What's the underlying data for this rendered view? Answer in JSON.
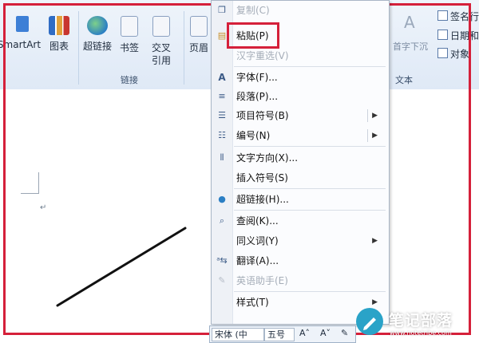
{
  "ribbon": {
    "buttons": [
      {
        "label": "SmartArt"
      },
      {
        "label": "图表"
      },
      {
        "label": "超链接"
      },
      {
        "label": "书签"
      },
      {
        "label": "交叉\n引用"
      },
      {
        "label": "页眉"
      }
    ],
    "group_links": "链接",
    "group_text": "文本",
    "first_letter": "首字下沉",
    "right_items": [
      "签名行",
      "日期和",
      "对象"
    ]
  },
  "context_menu": {
    "items": [
      {
        "label": "复制(C)",
        "disabled": true
      },
      {
        "label": "粘贴(P)",
        "disabled": false
      },
      {
        "label": "汉字重选(V)",
        "disabled": true
      },
      {
        "label": "字体(F)...",
        "disabled": false
      },
      {
        "label": "段落(P)...",
        "disabled": false
      },
      {
        "label": "项目符号(B)",
        "disabled": false,
        "submenu": true
      },
      {
        "label": "编号(N)",
        "disabled": false,
        "submenu": true
      },
      {
        "label": "文字方向(X)...",
        "disabled": false
      },
      {
        "label": "插入符号(S)",
        "disabled": false
      },
      {
        "label": "超链接(H)...",
        "disabled": false
      },
      {
        "label": "查阅(K)...",
        "disabled": false
      },
      {
        "label": "同义词(Y)",
        "disabled": false,
        "submenu": true
      },
      {
        "label": "翻译(A)...",
        "disabled": false
      },
      {
        "label": "英语助手(E)",
        "disabled": true
      },
      {
        "label": "样式(T)",
        "disabled": false,
        "submenu": true
      }
    ]
  },
  "mini_toolbar": {
    "font": "宋体 (中",
    "size": "五号"
  },
  "document": {
    "paragraph_mark": "↵"
  },
  "watermark": {
    "title": "笔记部落",
    "url": "www.notetribe.com"
  },
  "colors": {
    "highlight_frame": "#d5203a",
    "ribbon_bg": "#dfe9f6",
    "watermark_circle": "#2aa3c8"
  }
}
